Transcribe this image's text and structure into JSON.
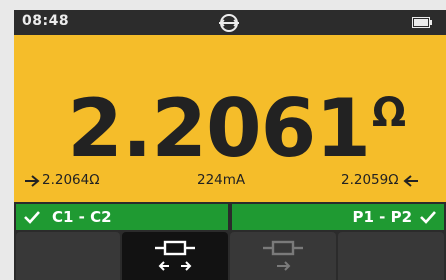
{
  "status": {
    "time": "08:48",
    "center_icon": "null-probe-icon",
    "battery_icon": "battery-icon"
  },
  "reading": {
    "value": "2.2061",
    "unit": "Ω",
    "forward_value": "2.2064Ω",
    "current": "224mA",
    "reverse_value": "2.2059Ω"
  },
  "checks": {
    "left_label": "C1 - C2",
    "right_label": "P1 - P2"
  },
  "softkeys": [
    {
      "name": "softkey-1",
      "icon": ""
    },
    {
      "name": "softkey-2",
      "icon": "bidirectional-measurement-icon",
      "active": true
    },
    {
      "name": "softkey-3",
      "icon": "single-direction-measurement-icon",
      "active": false
    },
    {
      "name": "softkey-4",
      "icon": ""
    }
  ],
  "colors": {
    "panel": "#f5bd2a",
    "pass": "#1f9a32",
    "bar": "#2c2c2c"
  }
}
